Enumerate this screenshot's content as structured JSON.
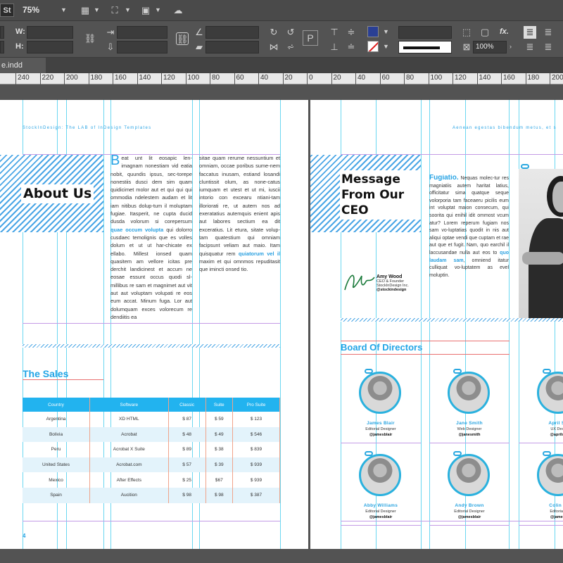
{
  "app": {
    "badge": "St",
    "zoom": "75%"
  },
  "control": {
    "w_label": "W:",
    "h_label": "H:",
    "zoom_percent": "100%",
    "fx": "fx."
  },
  "tab": {
    "name": "e.indd"
  },
  "ruler": {
    "ticks": [
      "240",
      "220",
      "200",
      "180",
      "160",
      "140",
      "120",
      "100",
      "80",
      "60",
      "40",
      "20",
      "0",
      "20",
      "40",
      "60",
      "80",
      "100",
      "120",
      "140",
      "160",
      "180",
      "200"
    ]
  },
  "left_page": {
    "header": "StockInDesign: The LAB of InDesign Templates",
    "title": "About Us",
    "drop_cap": "B",
    "col1": "eat unt lit eosapic len-imagnam nonestiam vid eatia nobit, quundis ipsus, sec-torepe nonestiis dusci dem sim quam quidicimet molor aut et qui qui qui ommodia ndelestem audam et lit iam nitibus dolup-tum il moluptam fugiae. Itasperit, ne cupta ducid dusda volorum si corepersum",
    "col1_link": "quae occum volupta",
    "col1b": "qui dolorro cusdaec temolignis que es volles dolum et ut ut har-chicate ex ellabo. Millest ionsed quam quasitem am vellore icitas pre derchit landicinest et accum ne eosae essunt occus quodi sl-millibus re sam et magnimet aut vit aut aut voluptam volupati re eos eum accat. Minum fuga. Lor aut dolumquam exces volorecum re dendiitis ea",
    "col2": "sitae quam rerume nessuntium et omniam, occae poribus sume-nem faccatus inusam, estiand losandi cluntissit olum, as none-catus iumquam et utest et ut mi, iuscii intorio con excearu ntiani-tam illoriorati re, ut autem nos ad exeratatius autemquis enient apis aut labores sectium ea dit exceratius. Lit etura, sitate volup-tam quatestium qui omniam facipsunt veliam aut maio. Itam quisquatur rem",
    "col2_link": "quiatorum vel il",
    "col2b": "maxim et qui omnmos repuditasit que imincti onsed tio.",
    "sales_title": "The Sales",
    "table": {
      "headers": [
        "Country",
        "Software",
        "Classic",
        "Suite",
        "Pro Suite"
      ],
      "rows": [
        [
          "Argentina",
          "XD HTML",
          "$ 87",
          "$ 59",
          "$ 123"
        ],
        [
          "Bolivia",
          "Acrobat",
          "$ 48",
          "$ 49",
          "$ 546"
        ],
        [
          "Peru",
          "Acrobat X Suite",
          "$ 89",
          "$ 38",
          "$ 839"
        ],
        [
          "United States",
          "Acrobat.com",
          "$ 57",
          "$ 39",
          "$ 939"
        ],
        [
          "Mexico",
          "After Effects",
          "$ 25",
          "$67",
          "$ 939"
        ],
        [
          "Spain",
          "Aucition",
          "$ 98",
          "$ 98",
          "$ 387"
        ]
      ]
    },
    "page_number": "4"
  },
  "right_page": {
    "header": "Aenean egestas bibendum metus, et s",
    "title": "Message From Our CEO",
    "lead": "Fugiatio.",
    "body1": "Nequas molec-tur res magniatiis autem haritat latius, officitatur sima quatque seque volorporia tam faceaeru picilis eum int voluptat maion consecum, qui soorita qui enihil idit ommost vcum atur? Lorem reperum fugiam nos sam vo-luptatias quodit in nis aut aliqui optae vendi que cuptam et rae aut que et fugit. Nam, quo earchil il laccusandae nulla aut eos to",
    "body1_link": "quo laudam sam",
    "body1b": ", omniend itatur culliquat vo-luptatem as evel moluptin.",
    "ceo_name": "Amy Wood",
    "ceo_role": "CEO & Founder",
    "ceo_company": "StockInDesign Inc.",
    "ceo_handle": "@stockindesign",
    "board_title": "Board Of Directors",
    "people": [
      {
        "name": "James Blair",
        "role": "Editorial Designer",
        "handle": "@jamesblair"
      },
      {
        "name": "Jane Smith",
        "role": "Web Designer",
        "handle": "@janesmith"
      },
      {
        "name": "April Sm",
        "role": "UX Desig",
        "handle": "@aprilsm"
      },
      {
        "name": "Abby Williams",
        "role": "Editorial Designer",
        "handle": "@jamesblair"
      },
      {
        "name": "Andy Brown",
        "role": "Editorial Designer",
        "handle": "@jamesblair"
      },
      {
        "name": "Colin Ta",
        "role": "Editorial D",
        "handle": "@jamesb"
      }
    ]
  }
}
